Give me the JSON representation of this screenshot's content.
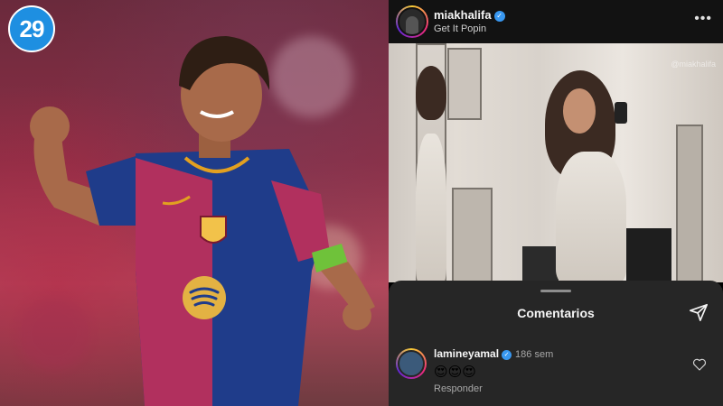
{
  "brand": {
    "logo_text": "29",
    "accent": "#1e8fe1"
  },
  "story": {
    "username": "miakhalifa",
    "verified": true,
    "song": "Get It Popin",
    "watermark": "@miakhalifa",
    "more_icon": "more-horizontal-icon"
  },
  "comments": {
    "title": "Comentarios",
    "send_icon": "send-icon",
    "items": [
      {
        "username": "lamineyamal",
        "verified": true,
        "time": "186 sem",
        "text": "😍😍😍",
        "reply_label": "Responder",
        "like_icon": "heart-outline-icon"
      }
    ]
  },
  "colors": {
    "ig_background": "#000000",
    "sheet_background": "#262626",
    "verified": "#3897f0"
  }
}
